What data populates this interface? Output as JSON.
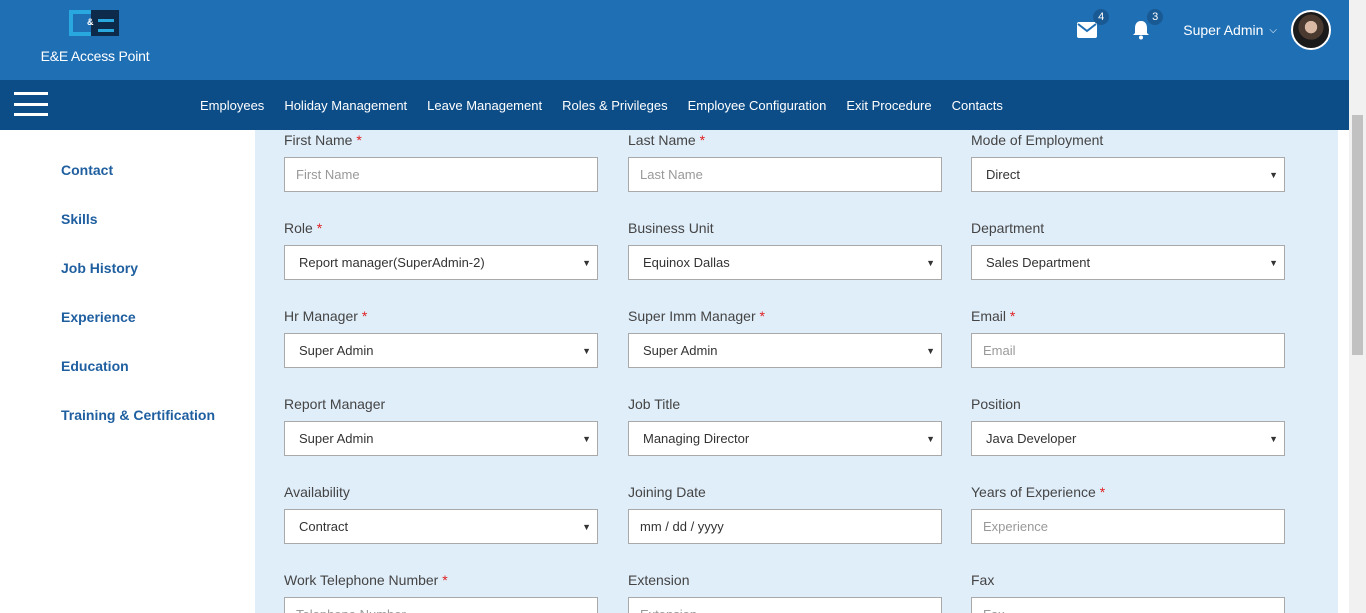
{
  "brand": {
    "name": "E&E Access Point"
  },
  "header": {
    "mail_count": "4",
    "notif_count": "3",
    "user_name": "Super Admin"
  },
  "nav": {
    "items": [
      "Employees",
      "Holiday Management",
      "Leave Management",
      "Roles & Privileges",
      "Employee Configuration",
      "Exit Procedure",
      "Contacts"
    ]
  },
  "sidebar": {
    "items": [
      "Contact",
      "Skills",
      "Job History",
      "Experience",
      "Education",
      "Training & Certification"
    ]
  },
  "form": {
    "first_name": {
      "label": "First Name",
      "placeholder": "First Name"
    },
    "last_name": {
      "label": "Last Name",
      "placeholder": "Last Name"
    },
    "mode": {
      "label": "Mode of Employment",
      "value": "Direct"
    },
    "role": {
      "label": "Role",
      "value": "Report manager(SuperAdmin-2)"
    },
    "business_unit": {
      "label": "Business Unit",
      "value": "Equinox Dallas"
    },
    "department": {
      "label": "Department",
      "value": "Sales Department"
    },
    "hr_manager": {
      "label": "Hr Manager",
      "value": "Super Admin"
    },
    "super_imm": {
      "label": "Super Imm Manager",
      "value": "Super Admin"
    },
    "email": {
      "label": "Email",
      "placeholder": "Email"
    },
    "report_manager": {
      "label": "Report Manager",
      "value": "Super Admin"
    },
    "job_title": {
      "label": "Job Title",
      "value": "Managing Director"
    },
    "position": {
      "label": "Position",
      "value": "Java Developer"
    },
    "availability": {
      "label": "Availability",
      "value": "Contract"
    },
    "joining_date": {
      "label": "Joining Date",
      "value": "mm / dd / yyyy"
    },
    "experience": {
      "label": "Years of Experience",
      "placeholder": "Experience"
    },
    "work_phone": {
      "label": "Work Telephone Number",
      "placeholder": "Telephone Number"
    },
    "extension": {
      "label": "Extension",
      "placeholder": "Extension"
    },
    "fax": {
      "label": "Fax",
      "placeholder": "Fax"
    },
    "required_mark": "*"
  },
  "colors": {
    "header": "#1f6fb5",
    "nav": "#0d4d87",
    "panel": "#e0eefa",
    "sidebar_link": "#1f5fa0",
    "required": "#e02020"
  },
  "icons": {
    "mail": "envelope-icon",
    "bell": "bell-icon",
    "menu": "hamburger-icon",
    "caret": "caret-down-icon"
  }
}
